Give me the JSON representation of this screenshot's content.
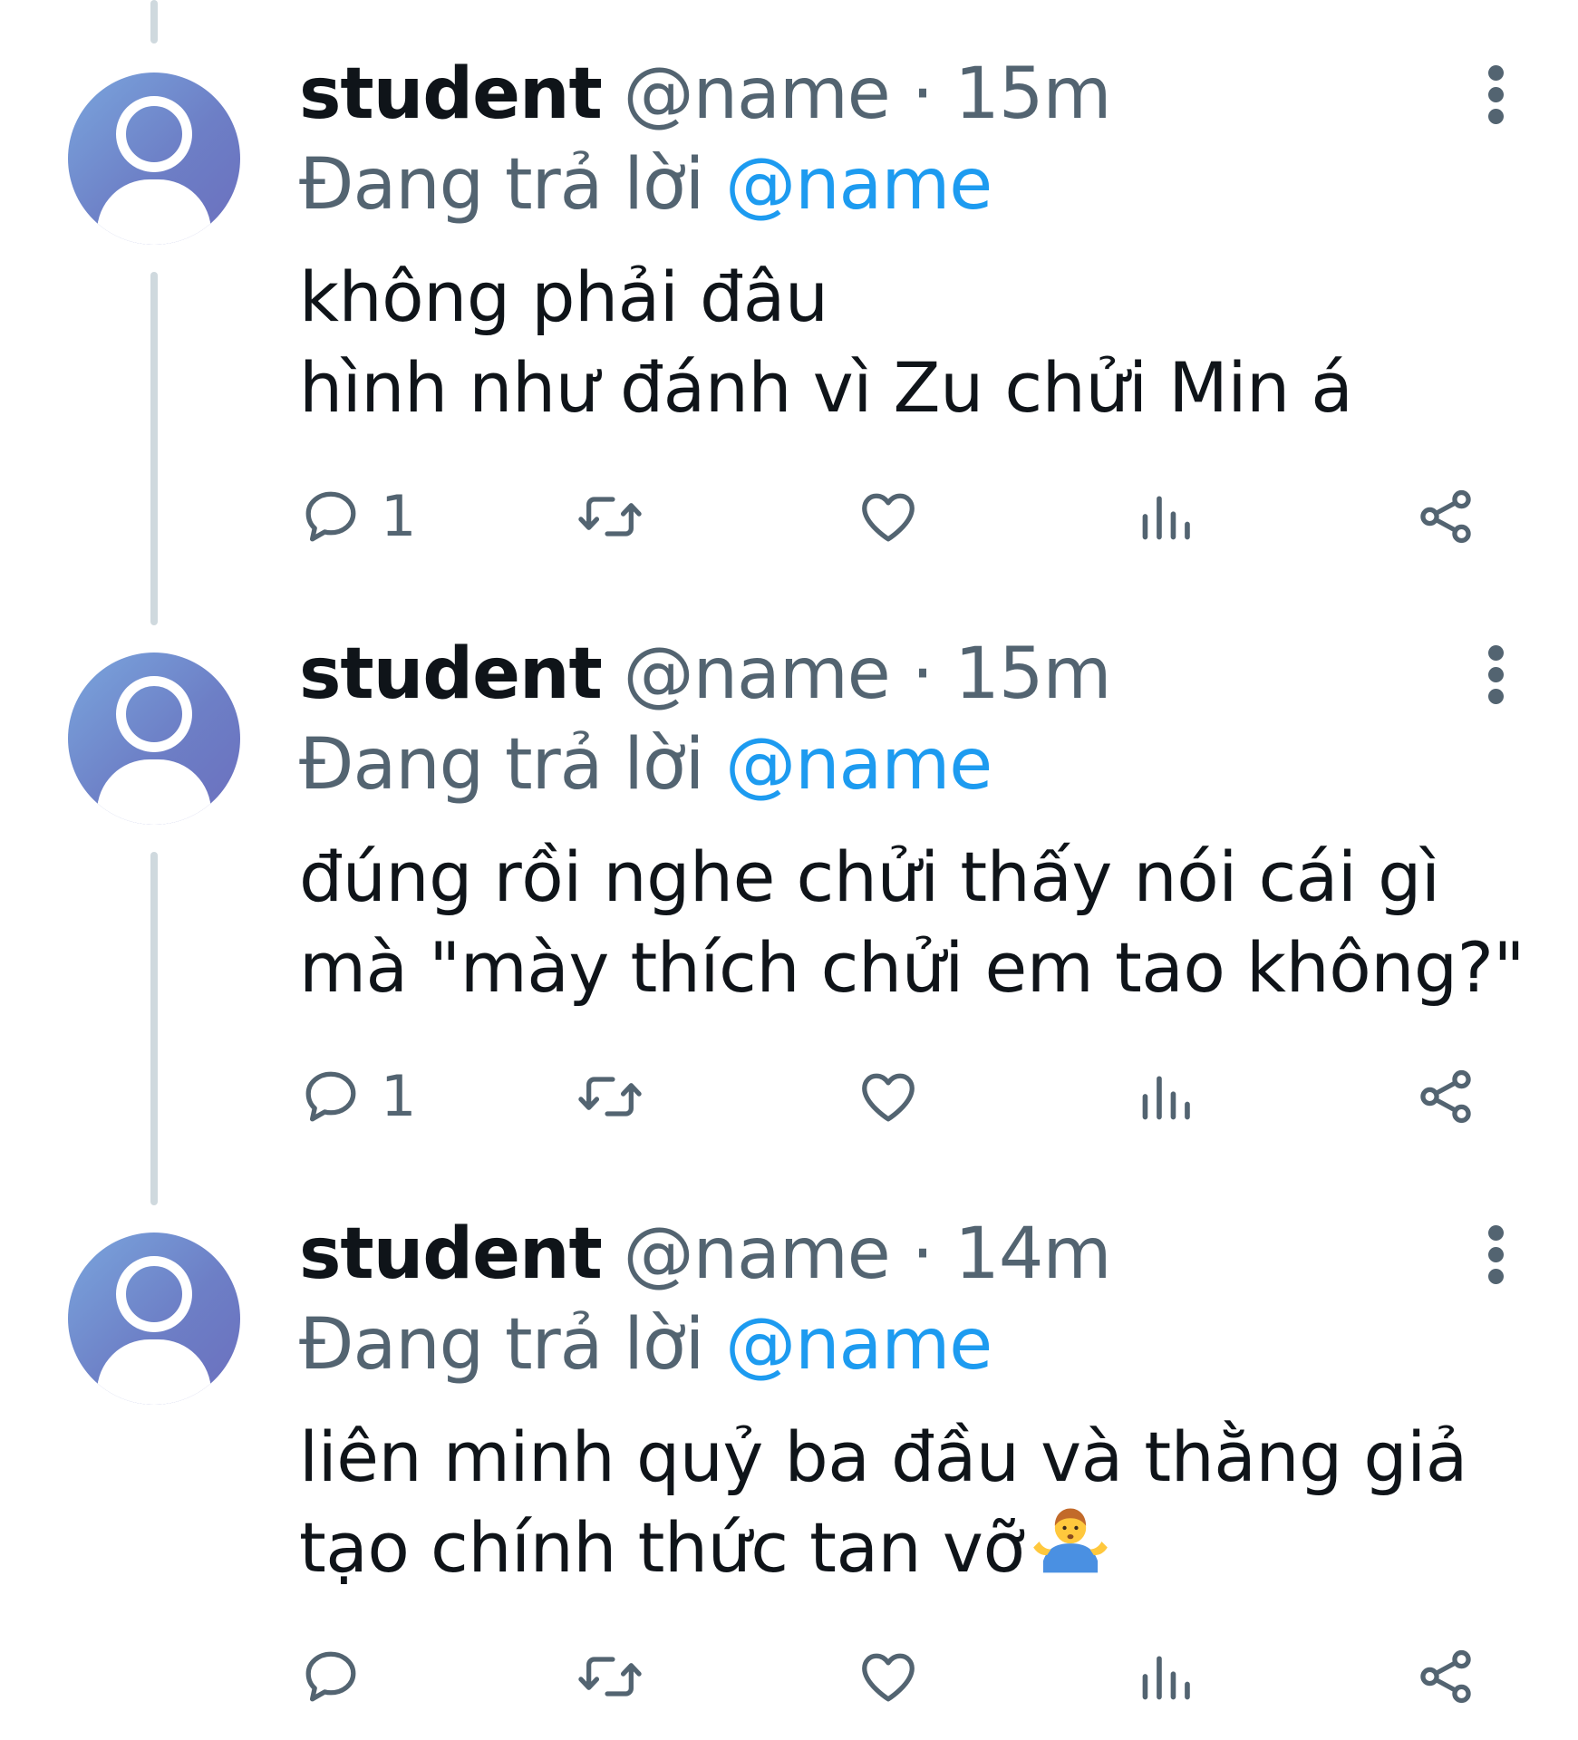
{
  "tweets": [
    {
      "display_name": "student",
      "handle": "@name",
      "separator": "·",
      "time": "15m",
      "replying_label": "Đang trả lời",
      "replying_to": "@name",
      "text_lines": [
        "không phải đâu",
        "hình như đánh vì Zu chửi Min á"
      ],
      "reply_count": "1"
    },
    {
      "display_name": "student",
      "handle": "@name",
      "separator": "·",
      "time": "15m",
      "replying_label": "Đang trả lời",
      "replying_to": "@name",
      "text_lines": [
        "đúng rồi nghe chửi thấy nói cái gì",
        "mà \"mày thích chửi em tao không?\""
      ],
      "reply_count": "1"
    },
    {
      "display_name": "student",
      "handle": "@name",
      "separator": "·",
      "time": "14m",
      "replying_label": "Đang trả lời",
      "replying_to": "@name",
      "text_lines": [
        "liên minh quỷ ba đầu và thằng giả",
        "tạo chính thức tan vỡ"
      ],
      "text_emoji": "person-shrugging-emoji",
      "reply_count": ""
    }
  ],
  "icons": {
    "reply": "reply-icon",
    "retweet": "retweet-icon",
    "like": "like-icon",
    "views": "views-icon",
    "share": "share-icon",
    "more": "more-vertical-icon",
    "avatar": "default-avatar-icon"
  },
  "colors": {
    "text": "#0f1419",
    "secondary": "#536471",
    "mention": "#1d9bf0",
    "thread_line": "#cfd9de",
    "avatar": "#6d7fc6"
  }
}
